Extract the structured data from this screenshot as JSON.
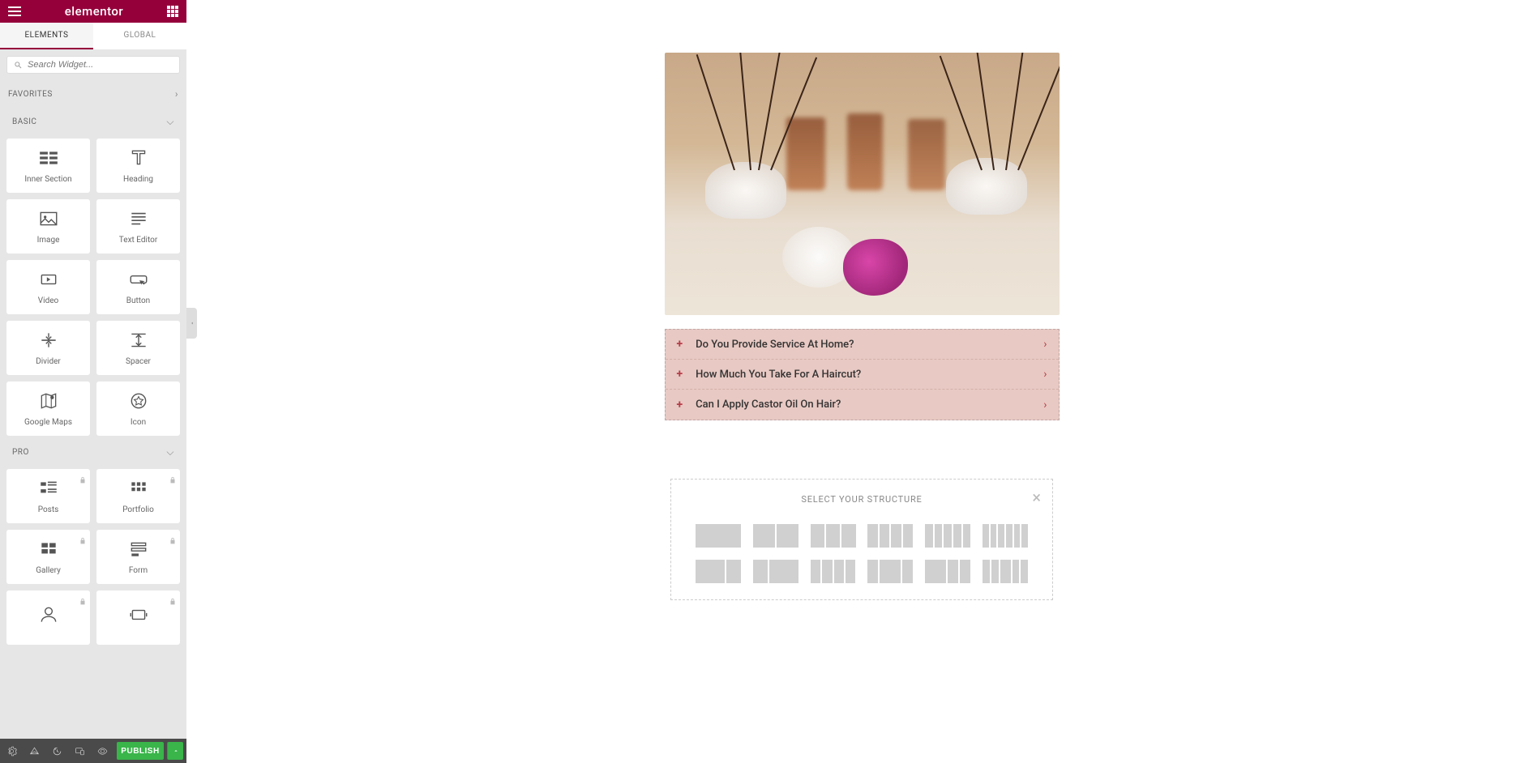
{
  "header": {
    "logo": "elementor"
  },
  "tabs": {
    "elements": "ELEMENTS",
    "global": "GLOBAL"
  },
  "search": {
    "placeholder": "Search Widget..."
  },
  "categories": {
    "favorites": "FAVORITES",
    "basic": "BASIC",
    "pro": "PRO"
  },
  "widgets": {
    "basic": [
      {
        "label": "Inner Section"
      },
      {
        "label": "Heading"
      },
      {
        "label": "Image"
      },
      {
        "label": "Text Editor"
      },
      {
        "label": "Video"
      },
      {
        "label": "Button"
      },
      {
        "label": "Divider"
      },
      {
        "label": "Spacer"
      },
      {
        "label": "Google Maps"
      },
      {
        "label": "Icon"
      }
    ],
    "pro": [
      {
        "label": "Posts"
      },
      {
        "label": "Portfolio"
      },
      {
        "label": "Gallery"
      },
      {
        "label": "Form"
      },
      {
        "label": ""
      },
      {
        "label": ""
      }
    ]
  },
  "footer": {
    "publish": "PUBLISH"
  },
  "accordion": [
    {
      "title": "Do You Provide Service At Home?"
    },
    {
      "title": "How Much You Take For A Haircut?"
    },
    {
      "title": "Can I Apply Castor Oil On Hair?"
    }
  ],
  "structure": {
    "title": "SELECT YOUR STRUCTURE",
    "options_row1": [
      [
        1
      ],
      [
        1,
        1
      ],
      [
        1,
        1,
        1
      ],
      [
        1,
        1,
        1,
        1
      ],
      [
        1,
        1,
        1,
        1,
        1
      ],
      [
        1,
        1,
        1,
        1,
        1,
        1
      ]
    ],
    "options_row2": [
      [
        2,
        1
      ],
      [
        1,
        2
      ],
      [
        1,
        1,
        1,
        1
      ],
      [
        1,
        2,
        1
      ],
      [
        2,
        1,
        1
      ],
      [
        1,
        1,
        2,
        1,
        1
      ]
    ]
  }
}
